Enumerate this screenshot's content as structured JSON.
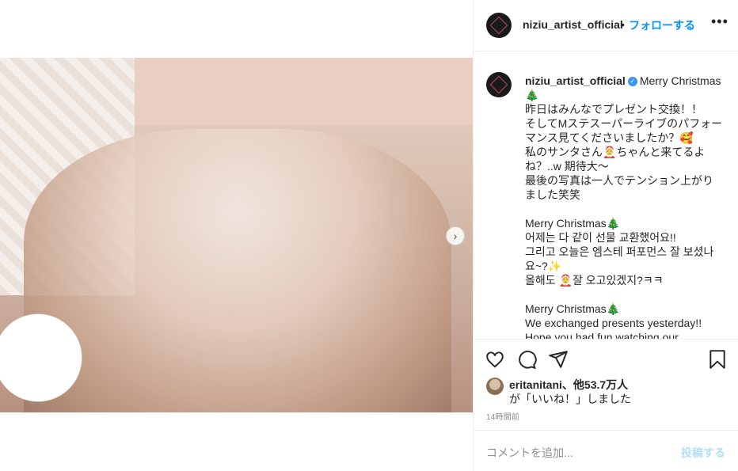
{
  "post": {
    "image": {
      "description_icon": "photo",
      "has_next": true
    },
    "next_icon": "chevron-right-icon"
  },
  "header": {
    "username": "niziu_artist_official",
    "dot": "•",
    "follow_label": "フォローする",
    "more_icon": "more-horizontal-icon",
    "more_label": "•••"
  },
  "caption": {
    "username": "niziu_artist_official",
    "verified_icon": "verified-badge-icon",
    "lines": [
      "Merry Christmas🎄",
      "昨日はみんなでプレゼント交換！！",
      "そしてMステスーパーライブのパフォーマンス見てくださいましたか？🥰",
      "私のサンタさん🤶ちゃんと来てるよね？..w 期待大〜",
      "最後の写真は一人でテンション上がりました笑笑",
      "",
      "Merry Christmas🎄",
      "어제는 다 같이 선물 교환했어요!!",
      "그리고 오늘은 엠스테 퍼포먼스 잘 보셨나요~?✨",
      "올해도 🤶잘 오고있겠지?ㅋㅋ",
      "",
      "Merry Christmas🎄",
      "We exchanged presents yesterday!!",
      "Hope you had fun watching our"
    ]
  },
  "actions": {
    "like_icon": "heart-icon",
    "comment_icon": "comment-icon",
    "share_icon": "share-icon",
    "save_icon": "bookmark-icon"
  },
  "likes": {
    "user": "eritanitani",
    "others": "、他53.7万人",
    "suffix": "が「いいね！」しました"
  },
  "timestamp": "14時間前",
  "comment": {
    "placeholder": "コメントを追加...",
    "post_label": "投稿する"
  },
  "colors": {
    "accent": "#0095f6",
    "post_disabled": "#b2dffc",
    "text": "#262626",
    "muted": "#8e8e8e",
    "verified": "#3897f0"
  }
}
